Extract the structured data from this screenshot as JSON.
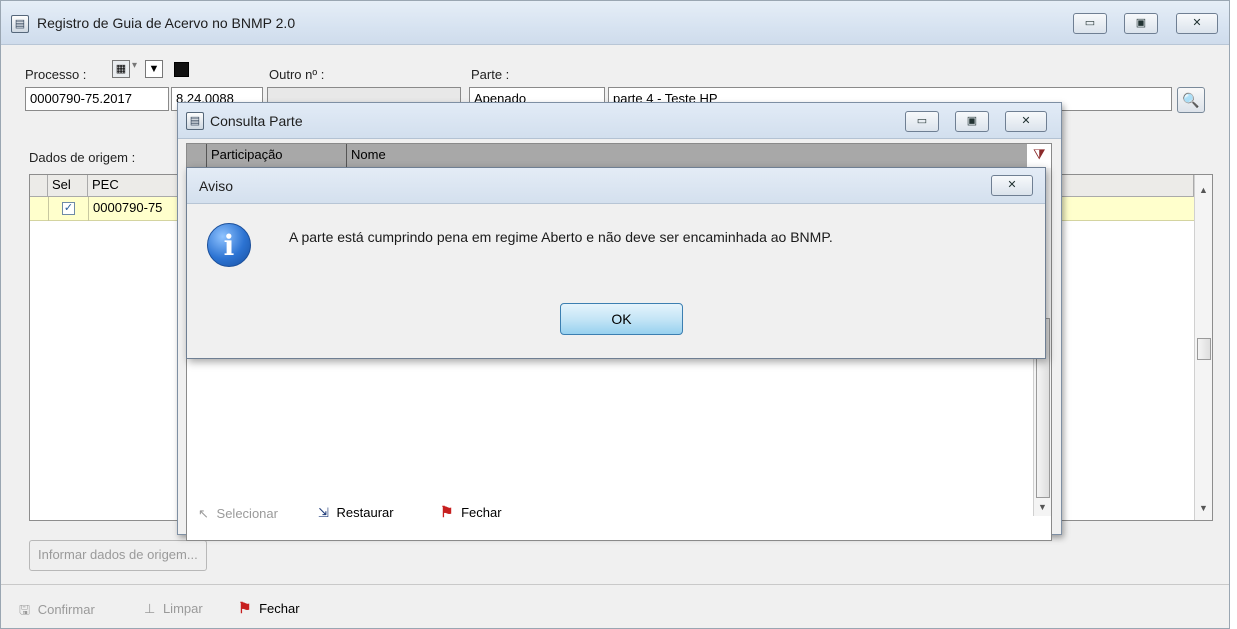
{
  "main_window": {
    "title": "Registro de Guia de Acervo no BNMP 2.0",
    "controls": {
      "minimize": "▭",
      "maximize": "▣",
      "close": "✕"
    }
  },
  "form": {
    "processo_label": "Processo :",
    "processo_value": "0000790-75.2017",
    "processo_suffix": "8.24.0088",
    "outro_label": "Outro nº :",
    "outro_value": "",
    "parte_label": "Parte :",
    "parte_tipo": "Apenado",
    "parte_nome": "parte 4 - Teste HP",
    "dados_label": "Dados de origem :"
  },
  "main_grid": {
    "columns": [
      "Sel",
      "PEC"
    ],
    "rows": [
      {
        "checked": true,
        "pec": "0000790-75"
      }
    ]
  },
  "informar_button": "Informar dados de origem...",
  "main_toolbar": {
    "confirmar": "Confirmar",
    "limpar": "Limpar",
    "fechar": "Fechar"
  },
  "consulta_dialog": {
    "title": "Consulta Parte",
    "columns": [
      "Participação",
      "Nome"
    ],
    "toolbar": {
      "selecionar": "Selecionar",
      "restaurar": "Restaurar",
      "fechar": "Fechar"
    }
  },
  "aviso_dialog": {
    "title": "Aviso",
    "message": "A parte está cumprindo pena em regime Aberto e não deve ser encaminhada ao BNMP.",
    "ok_label": "OK"
  },
  "colors": {
    "selected_row": "#ffffcc",
    "flag_red": "#c71f1f",
    "ok_button": "#98d1ef",
    "info_icon": "#2c73d2"
  }
}
